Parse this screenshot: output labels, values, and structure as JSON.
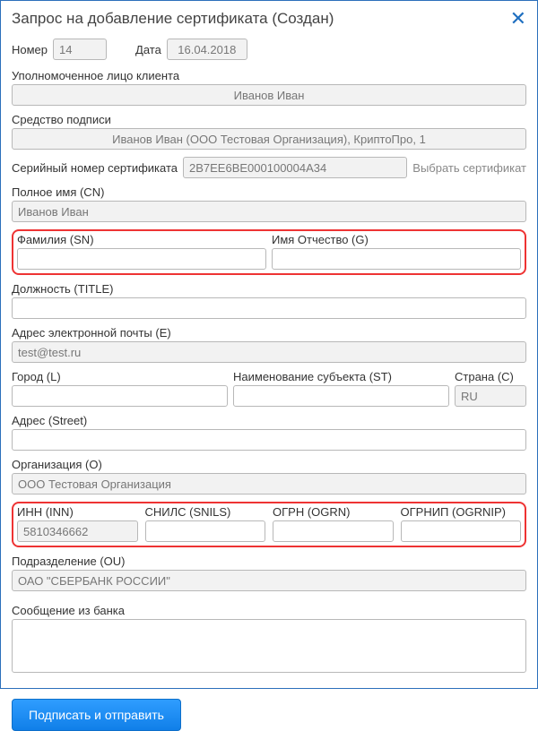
{
  "window": {
    "title": "Запрос на добавление сертификата (Создан)"
  },
  "header": {
    "number_label": "Номер",
    "number_value": "14",
    "date_label": "Дата",
    "date_value": "16.04.2018"
  },
  "client_rep": {
    "label": "Уполномоченное лицо клиента",
    "value": "Иванов Иван"
  },
  "sign_tool": {
    "label": "Средство подписи",
    "value": "Иванов Иван (ООО Тестовая Организация), КриптоПро, 1"
  },
  "serial": {
    "label": "Серийный номер сертификата",
    "value": "2B7EE6BE000100004A34",
    "select_link": "Выбрать сертификат"
  },
  "cn": {
    "label": "Полное имя (CN)",
    "value": "Иванов Иван"
  },
  "sn_g": {
    "sn_label": "Фамилия (SN)",
    "sn_value": "",
    "g_label": "Имя Отчество (G)",
    "g_value": ""
  },
  "title_f": {
    "label": "Должность (TITLE)",
    "value": ""
  },
  "email": {
    "label": "Адрес электронной почты (E)",
    "value": "test@test.ru"
  },
  "geo": {
    "city_label": "Город (L)",
    "city_value": "",
    "state_label": "Наименование субъекта (ST)",
    "state_value": "",
    "country_label": "Страна (C)",
    "country_value": "RU"
  },
  "street": {
    "label": "Адрес (Street)",
    "value": ""
  },
  "org": {
    "label": "Организация (O)",
    "value": "ООО Тестовая Организация"
  },
  "codes": {
    "inn_label": "ИНН (INN)",
    "inn_value": "5810346662",
    "snils_label": "СНИЛС (SNILS)",
    "snils_value": "",
    "ogrn_label": "ОГРН (OGRN)",
    "ogrn_value": "",
    "ogrnip_label": "ОГРНИП (OGRNIP)",
    "ogrnip_value": ""
  },
  "ou": {
    "label": "Подразделение (OU)",
    "value": "ОАО \"СБЕРБАНК РОССИИ\""
  },
  "bank_msg": {
    "label": "Сообщение из банка",
    "value": ""
  },
  "actions": {
    "submit": "Подписать и отправить"
  }
}
